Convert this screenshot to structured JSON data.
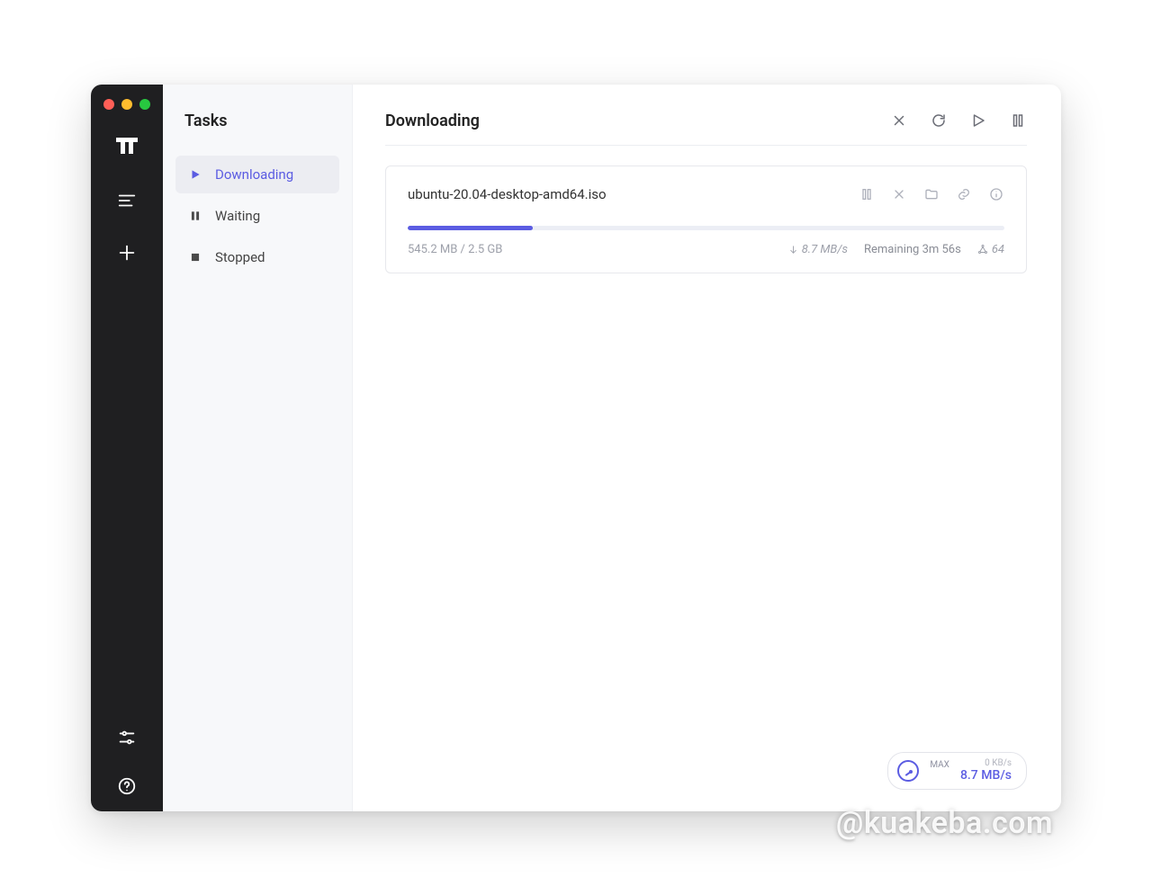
{
  "sidebar": {
    "title": "Tasks",
    "items": [
      {
        "label": "Downloading",
        "icon": "play-icon",
        "active": true
      },
      {
        "label": "Waiting",
        "icon": "pause-icon",
        "active": false
      },
      {
        "label": "Stopped",
        "icon": "stop-icon",
        "active": false
      }
    ]
  },
  "main": {
    "title": "Downloading",
    "header_actions": [
      "close",
      "refresh",
      "resume",
      "pause"
    ]
  },
  "task": {
    "name": "ubuntu-20.04-desktop-amd64.iso",
    "progress_percent": 21,
    "size_text": "545.2 MB / 2.5 GB",
    "speed_text": "8.7 MB/s",
    "remaining_text": "Remaining 3m 56s",
    "peers_text": "64",
    "actions": [
      "pause",
      "stop",
      "folder",
      "link",
      "info"
    ]
  },
  "speed_widget": {
    "max_label": "MAX",
    "upload": "0 KB/s",
    "download": "8.7 MB/s"
  },
  "watermark": "@kuakeba.com"
}
